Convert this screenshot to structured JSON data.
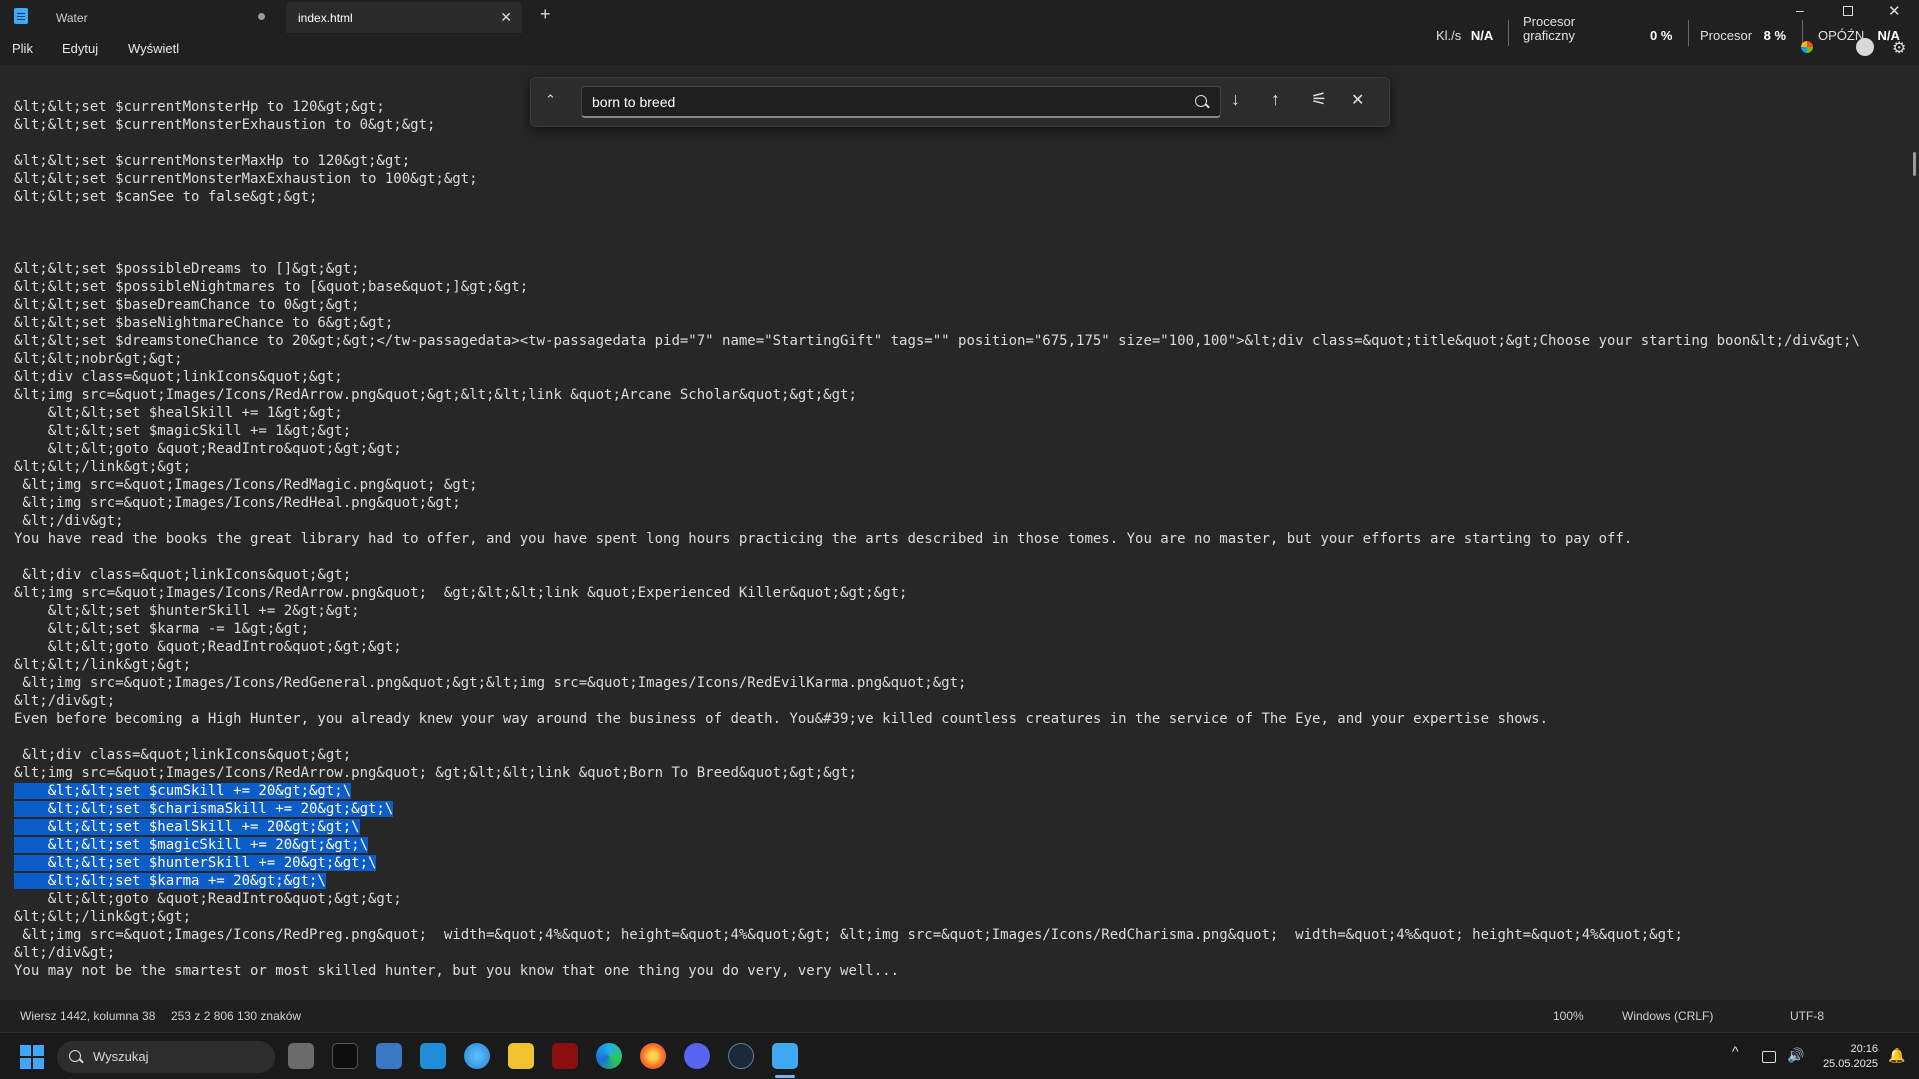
{
  "titlebar": {
    "tabs": [
      {
        "label": "Water",
        "modified": true
      },
      {
        "label": "index.html",
        "active": true
      }
    ],
    "close_glyph": "✕",
    "add_glyph": "+",
    "min_glyph": "–",
    "winclose_glyph": "✕"
  },
  "menu": [
    "Plik",
    "Edytuj",
    "Wyświetl"
  ],
  "perf": {
    "kls_label": "Kl./s",
    "kls_value": "N/A",
    "gpu_label_1": "Procesor",
    "gpu_label_2": "graficzny",
    "gpu_value": "0 %",
    "cpu_label": "Procesor",
    "cpu_value": "8 %",
    "latency_label": "OPÓŹN.",
    "latency_value": "N/A"
  },
  "find": {
    "query": "born to breed",
    "toggle_glyph": "⌃",
    "next_glyph": "↓",
    "prev_glyph": "↑",
    "options_glyph": "⚟",
    "close_glyph": "✕"
  },
  "code_lines": [
    {
      "text": "&lt;&lt;set $currentMonsterHp to 120&gt;&gt;"
    },
    {
      "text": "&lt;&lt;set $currentMonsterExhaustion to 0&gt;&gt;"
    },
    {
      "text": ""
    },
    {
      "text": "&lt;&lt;set $currentMonsterMaxHp to 120&gt;&gt;"
    },
    {
      "text": "&lt;&lt;set $currentMonsterMaxExhaustion to 100&gt;&gt;"
    },
    {
      "text": "&lt;&lt;set $canSee to false&gt;&gt;"
    },
    {
      "text": ""
    },
    {
      "text": ""
    },
    {
      "text": ""
    },
    {
      "text": "&lt;&lt;set $possibleDreams to []&gt;&gt;"
    },
    {
      "text": "&lt;&lt;set $possibleNightmares to [&quot;base&quot;]&gt;&gt;"
    },
    {
      "text": "&lt;&lt;set $baseDreamChance to 0&gt;&gt;"
    },
    {
      "text": "&lt;&lt;set $baseNightmareChance to 6&gt;&gt;"
    },
    {
      "text": "&lt;&lt;set $dreamstoneChance to 20&gt;&gt;</tw-passagedata><tw-passagedata pid=\"7\" name=\"StartingGift\" tags=\"\" position=\"675,175\" size=\"100,100\">&lt;div class=&quot;title&quot;&gt;Choose your starting boon&lt;/div&gt;\\"
    },
    {
      "text": "&lt;&lt;nobr&gt;&gt;"
    },
    {
      "text": "&lt;div class=&quot;linkIcons&quot;&gt;"
    },
    {
      "text": "&lt;img src=&quot;Images/Icons/RedArrow.png&quot;&gt;&lt;&lt;link &quot;Arcane Scholar&quot;&gt;&gt;"
    },
    {
      "text": "    &lt;&lt;set $healSkill += 1&gt;&gt;"
    },
    {
      "text": "    &lt;&lt;set $magicSkill += 1&gt;&gt;"
    },
    {
      "text": "    &lt;&lt;goto &quot;ReadIntro&quot;&gt;&gt;"
    },
    {
      "text": "&lt;&lt;/link&gt;&gt;"
    },
    {
      "text": " &lt;img src=&quot;Images/Icons/RedMagic.png&quot; &gt;"
    },
    {
      "text": " &lt;img src=&quot;Images/Icons/RedHeal.png&quot;&gt;"
    },
    {
      "text": " &lt;/div&gt;"
    },
    {
      "text": "You have read the books the great library had to offer, and you have spent long hours practicing the arts described in those tomes. You are no master, but your efforts are starting to pay off."
    },
    {
      "text": ""
    },
    {
      "text": " &lt;div class=&quot;linkIcons&quot;&gt;"
    },
    {
      "text": "&lt;img src=&quot;Images/Icons/RedArrow.png&quot;  &gt;&lt;&lt;link &quot;Experienced Killer&quot;&gt;&gt;"
    },
    {
      "text": "    &lt;&lt;set $hunterSkill += 2&gt;&gt;"
    },
    {
      "text": "    &lt;&lt;set $karma -= 1&gt;&gt;"
    },
    {
      "text": "    &lt;&lt;goto &quot;ReadIntro&quot;&gt;&gt;"
    },
    {
      "text": "&lt;&lt;/link&gt;&gt;"
    },
    {
      "text": " &lt;img src=&quot;Images/Icons/RedGeneral.png&quot;&gt;&lt;img src=&quot;Images/Icons/RedEvilKarma.png&quot;&gt;"
    },
    {
      "text": "&lt;/div&gt;"
    },
    {
      "text": "Even before becoming a High Hunter, you already knew your way around the business of death. You&#39;ve killed countless creatures in the service of The Eye, and your expertise shows."
    },
    {
      "text": ""
    },
    {
      "text": " &lt;div class=&quot;linkIcons&quot;&gt;"
    },
    {
      "text": "&lt;img src=&quot;Images/Icons/RedArrow.png&quot; &gt;&lt;&lt;link &quot;Born To Breed&quot;&gt;&gt;"
    },
    {
      "text": "    &lt;&lt;set $cumSkill += 20&gt;&gt;\\",
      "selected": true
    },
    {
      "text": "    &lt;&lt;set $charismaSkill += 20&gt;&gt;\\",
      "selected": true
    },
    {
      "text": "    &lt;&lt;set $healSkill += 20&gt;&gt;\\",
      "selected": true
    },
    {
      "text": "    &lt;&lt;set $magicSkill += 20&gt;&gt;\\",
      "selected": true
    },
    {
      "text": "    &lt;&lt;set $hunterSkill += 20&gt;&gt;\\",
      "selected": true
    },
    {
      "text": "    &lt;&lt;set $karma += 20&gt;&gt;\\",
      "selected": true
    },
    {
      "text": "    &lt;&lt;goto &quot;ReadIntro&quot;&gt;&gt;"
    },
    {
      "text": "&lt;&lt;/link&gt;&gt;"
    },
    {
      "text": " &lt;img src=&quot;Images/Icons/RedPreg.png&quot;  width=&quot;4%&quot; height=&quot;4%&quot;&gt; &lt;img src=&quot;Images/Icons/RedCharisma.png&quot;  width=&quot;4%&quot; height=&quot;4%&quot;&gt;"
    },
    {
      "text": "&lt;/div&gt;"
    },
    {
      "text": "You may not be the smartest or most skilled hunter, but you know that one thing you do very, very well..."
    }
  ],
  "status": {
    "position": "Wiersz 1442, kolumna 38",
    "selection": "253 z 2 806 130 znaków",
    "zoom": "100%",
    "line_ending": "Windows (CRLF)",
    "encoding": "UTF-8"
  },
  "taskbar": {
    "search_label": "Wyszukaj",
    "time": "20:16",
    "date": "25.05.2025",
    "tray_chevron": "^"
  }
}
